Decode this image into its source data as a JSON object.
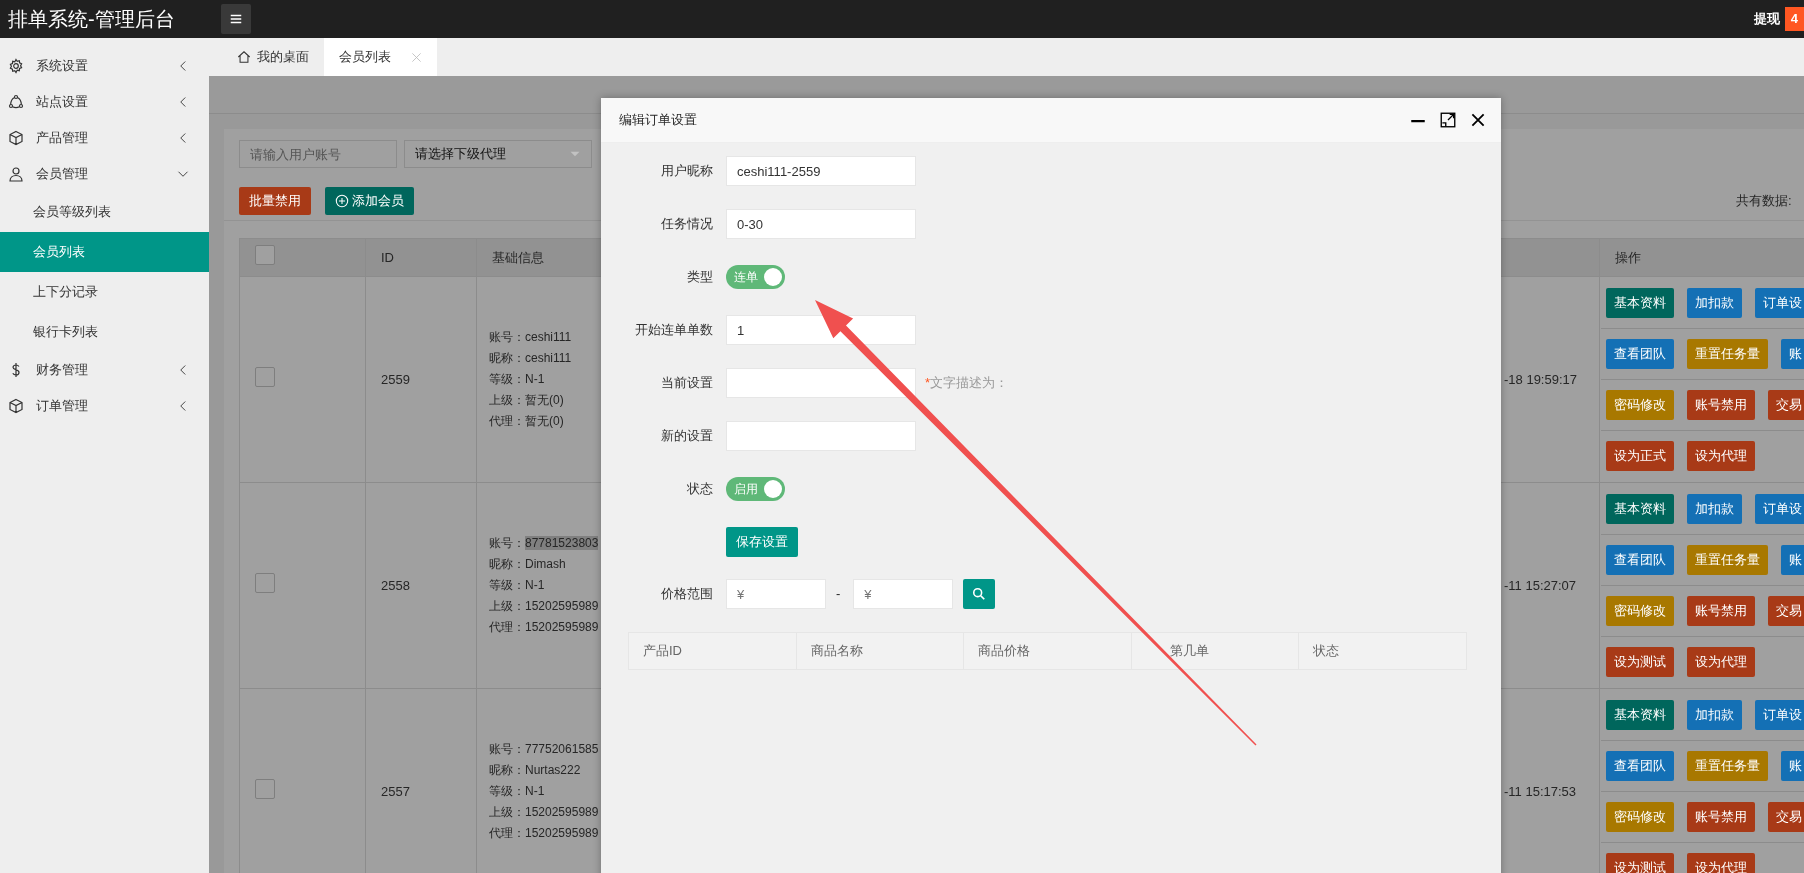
{
  "app_title": "排单系统-管理后台",
  "withdraw": {
    "label": "提现",
    "count": "4"
  },
  "sidebar": {
    "items": [
      {
        "label": "系统设置",
        "expanded": false
      },
      {
        "label": "站点设置",
        "expanded": false
      },
      {
        "label": "产品管理",
        "expanded": false
      },
      {
        "label": "会员管理",
        "expanded": true,
        "children": [
          {
            "label": "会员等级列表",
            "selected": false
          },
          {
            "label": "会员列表",
            "selected": true
          },
          {
            "label": "上下分记录",
            "selected": false
          },
          {
            "label": "银行卡列表",
            "selected": false
          }
        ]
      },
      {
        "label": "财务管理",
        "expanded": false
      },
      {
        "label": "订单管理",
        "expanded": false
      }
    ]
  },
  "tabs": [
    {
      "label": "我的桌面",
      "selected": false,
      "closable": false
    },
    {
      "label": "会员列表",
      "selected": true,
      "closable": true
    }
  ],
  "toolbar": {
    "search_placeholder": "请输入用户账号",
    "agent_select": "请选择下级代理",
    "buttons": [
      {
        "label": "批量禁用",
        "kind": "danger"
      },
      {
        "label": "添加会员",
        "kind": "add"
      }
    ],
    "total_label": "共有数据:"
  },
  "table": {
    "columns": [
      "ID",
      "基础信息",
      "操作"
    ],
    "header_checked": false,
    "rows": [
      {
        "checked": false,
        "id": "2559",
        "info": [
          {
            "label": "账号：",
            "value": "ceshi111",
            "highlighted": false
          },
          {
            "label": "昵称：",
            "value": "ceshi111",
            "highlighted": false
          },
          {
            "label": "等级：",
            "value": "N-1",
            "highlighted": false
          },
          {
            "label": "上级：",
            "value": "暂无(0)",
            "highlighted": false
          },
          {
            "label": "代理：",
            "value": "暂无(0)",
            "highlighted": false
          }
        ],
        "time": "-18 19:59:17",
        "actions": [
          [
            {
              "label": "基本资料",
              "color": "#00665c"
            },
            {
              "label": "加扣款",
              "color": "#1470b5"
            },
            {
              "label": "订单设",
              "color": "#1470b5"
            }
          ],
          [
            {
              "label": "查看团队",
              "color": "#1470b5"
            },
            {
              "label": "重置任务量",
              "color": "#a87800"
            },
            {
              "label": "账",
              "color": "#1470b5"
            }
          ],
          [
            {
              "label": "密码修改",
              "color": "#a87800"
            },
            {
              "label": "账号禁用",
              "color": "#a83a17"
            },
            {
              "label": "交易",
              "color": "#a83a17"
            }
          ],
          [
            {
              "label": "设为正式",
              "color": "#a83a17"
            },
            {
              "label": "设为代理",
              "color": "#a83a17"
            }
          ]
        ]
      },
      {
        "checked": false,
        "id": "2558",
        "info": [
          {
            "label": "账号：",
            "value": "87781523803",
            "highlighted": true
          },
          {
            "label": "昵称：",
            "value": "Dimash",
            "highlighted": false
          },
          {
            "label": "等级：",
            "value": "N-1",
            "highlighted": false
          },
          {
            "label": "上级：",
            "value": "15202595989",
            "highlighted": false
          },
          {
            "label": "代理：",
            "value": "15202595989",
            "highlighted": false
          }
        ],
        "time": "-11 15:27:07",
        "actions": [
          [
            {
              "label": "基本资料",
              "color": "#00665c"
            },
            {
              "label": "加扣款",
              "color": "#1470b5"
            },
            {
              "label": "订单设",
              "color": "#1470b5"
            }
          ],
          [
            {
              "label": "查看团队",
              "color": "#1470b5"
            },
            {
              "label": "重置任务量",
              "color": "#a87800"
            },
            {
              "label": "账",
              "color": "#1470b5"
            }
          ],
          [
            {
              "label": "密码修改",
              "color": "#a87800"
            },
            {
              "label": "账号禁用",
              "color": "#a83a17"
            },
            {
              "label": "交易",
              "color": "#a83a17"
            }
          ],
          [
            {
              "label": "设为测试",
              "color": "#a83a17"
            },
            {
              "label": "设为代理",
              "color": "#a83a17"
            }
          ]
        ]
      },
      {
        "checked": false,
        "id": "2557",
        "info": [
          {
            "label": "账号：",
            "value": "77752061585",
            "highlighted": false
          },
          {
            "label": "昵称：",
            "value": "Nurtas222",
            "highlighted": false
          },
          {
            "label": "等级：",
            "value": "N-1",
            "highlighted": false
          },
          {
            "label": "上级：",
            "value": "15202595989",
            "highlighted": false
          },
          {
            "label": "代理：",
            "value": "15202595989",
            "highlighted": false
          }
        ],
        "time": "-11 15:17:53",
        "actions": [
          [
            {
              "label": "基本资料",
              "color": "#00665c"
            },
            {
              "label": "加扣款",
              "color": "#1470b5"
            },
            {
              "label": "订单设",
              "color": "#1470b5"
            }
          ],
          [
            {
              "label": "查看团队",
              "color": "#1470b5"
            },
            {
              "label": "重置任务量",
              "color": "#a87800"
            },
            {
              "label": "账",
              "color": "#1470b5"
            }
          ],
          [
            {
              "label": "密码修改",
              "color": "#a87800"
            },
            {
              "label": "账号禁用",
              "color": "#a83a17"
            },
            {
              "label": "交易",
              "color": "#a83a17"
            }
          ],
          [
            {
              "label": "设为测试",
              "color": "#a83a17"
            },
            {
              "label": "设为代理",
              "color": "#a83a17"
            }
          ]
        ]
      }
    ]
  },
  "modal": {
    "title": "编辑订单设置",
    "fields": [
      {
        "kind": "input",
        "label": "用户昵称",
        "value": "ceshi111-2559"
      },
      {
        "kind": "input",
        "label": "任务情况",
        "value": "0-30"
      },
      {
        "kind": "switch",
        "label": "类型",
        "text": "连单",
        "on": true
      },
      {
        "kind": "input",
        "label": "开始连单单数",
        "value": "1"
      },
      {
        "kind": "input",
        "label": "当前设置",
        "note_mark": "*",
        "note": "文字描述为："
      },
      {
        "kind": "input",
        "label": "新的设置"
      },
      {
        "kind": "switch",
        "label": "状态",
        "text": "启用",
        "on": true
      },
      {
        "kind": "button",
        "label": "保存设置"
      },
      {
        "kind": "range",
        "label": "价格范围",
        "from_placeholder": "¥",
        "separator": "-",
        "to_placeholder": "¥"
      }
    ],
    "product_columns": [
      "产品ID",
      "商品名称",
      "商品价格",
      "第几单",
      "状态"
    ]
  }
}
